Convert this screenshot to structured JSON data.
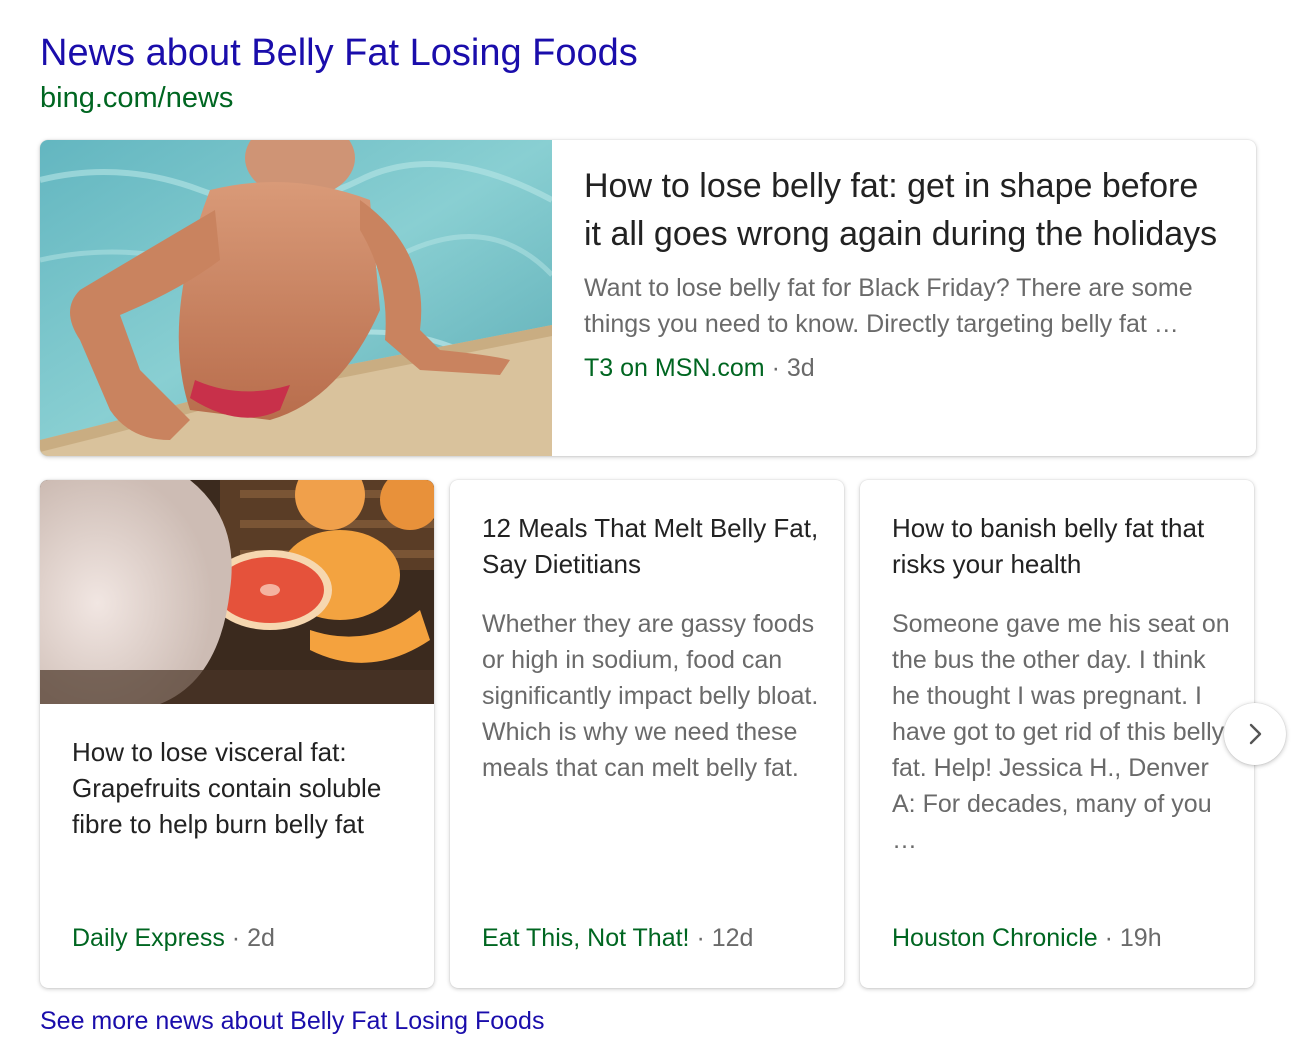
{
  "header": {
    "title": "News about Belly Fat Losing Foods",
    "source": "bing.com/news"
  },
  "featured": {
    "headline": "How to lose belly fat: get in shape before it all goes wrong again during the holidays",
    "snippet": "Want to lose belly fat for Black Friday? There are some things you need to know. Directly targeting belly fat …",
    "publisher": "T3 on MSN.com",
    "separator": "·",
    "age": "3d"
  },
  "cards": [
    {
      "headline": "How to lose visceral fat: Grapefruits contain soluble fibre to help burn belly fat",
      "publisher": "Daily Express",
      "separator": "·",
      "age": "2d"
    },
    {
      "headline": "12 Meals That Melt Belly Fat, Say Dietitians",
      "snippet": "Whether they are gassy foods or high in sodium, food can significantly impact belly bloat. Which is why we need these meals that can melt belly fat.",
      "publisher": "Eat This, Not That!",
      "separator": "·",
      "age": "12d"
    },
    {
      "headline": "How to banish belly fat that risks your health",
      "snippet": "Someone gave me his seat on the bus the other day. I think he thought I was pregnant. I have got to get rid of this belly fat. Help! Jessica H., Denver A: For decades, many of you …",
      "publisher": "Houston Chronicle",
      "separator": "·",
      "age": "19h"
    }
  ],
  "footer": {
    "see_more": "See more news about Belly Fat Losing Foods"
  },
  "icons": {
    "next": "chevron-right-icon"
  },
  "colors": {
    "link": "#1a0dab",
    "source_green": "#006621",
    "meta_gray": "#6a6a6a",
    "headline": "#222222"
  }
}
